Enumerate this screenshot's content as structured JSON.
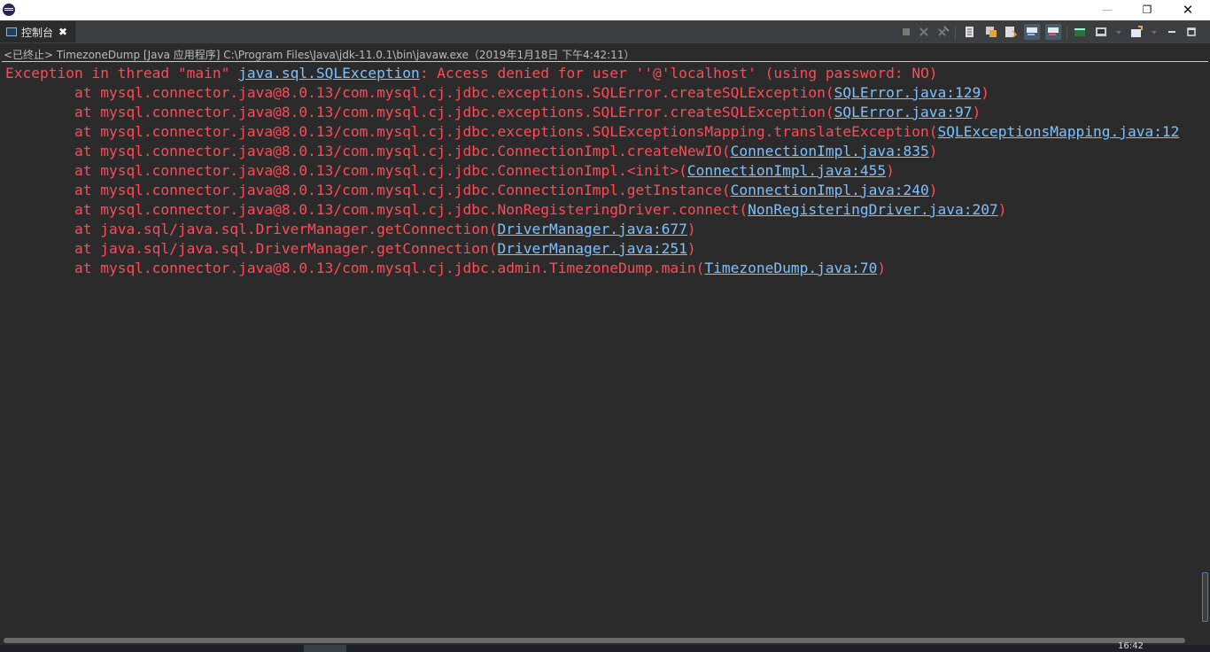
{
  "window": {
    "minimize": "—",
    "restore": "❐",
    "close": "✕"
  },
  "tab": {
    "label": "控制台",
    "close": "✖"
  },
  "toolbar": {
    "icons": [
      "terminate-icon",
      "remove-launch-icon",
      "remove-all-icon",
      "scroll-lock-icon",
      "word-wrap-icon",
      "show-on-output-icon",
      "show-on-error-icon",
      "pin-console-icon",
      "display-console-icon",
      "open-console-icon",
      "minimize-view-icon",
      "maximize-view-icon"
    ]
  },
  "console": {
    "title": "<已终止> TimezoneDump [Java 应用程序] C:\\Program Files\\Java\\jdk-11.0.1\\bin\\javaw.exe（2019年1月18日 下午4:42:11）",
    "lines": [
      {
        "pre": "Exception in thread \"main\" ",
        "link": "java.sql.SQLException",
        "post": ": Access denied for user ''@'localhost' (using password: NO)"
      },
      {
        "pre": "        at mysql.connector.java@8.0.13/com.mysql.cj.jdbc.exceptions.SQLError.createSQLException(",
        "link": "SQLError.java:129",
        "post": ")"
      },
      {
        "pre": "        at mysql.connector.java@8.0.13/com.mysql.cj.jdbc.exceptions.SQLError.createSQLException(",
        "link": "SQLError.java:97",
        "post": ")"
      },
      {
        "pre": "        at mysql.connector.java@8.0.13/com.mysql.cj.jdbc.exceptions.SQLExceptionsMapping.translateException(",
        "link": "SQLExceptionsMapping.java:12",
        "post": ""
      },
      {
        "pre": "        at mysql.connector.java@8.0.13/com.mysql.cj.jdbc.ConnectionImpl.createNewIO(",
        "link": "ConnectionImpl.java:835",
        "post": ")"
      },
      {
        "pre": "        at mysql.connector.java@8.0.13/com.mysql.cj.jdbc.ConnectionImpl.<init>(",
        "link": "ConnectionImpl.java:455",
        "post": ")"
      },
      {
        "pre": "        at mysql.connector.java@8.0.13/com.mysql.cj.jdbc.ConnectionImpl.getInstance(",
        "link": "ConnectionImpl.java:240",
        "post": ")"
      },
      {
        "pre": "        at mysql.connector.java@8.0.13/com.mysql.cj.jdbc.NonRegisteringDriver.connect(",
        "link": "NonRegisteringDriver.java:207",
        "post": ")"
      },
      {
        "pre": "        at java.sql/java.sql.DriverManager.getConnection(",
        "link": "DriverManager.java:677",
        "post": ")"
      },
      {
        "pre": "        at java.sql/java.sql.DriverManager.getConnection(",
        "link": "DriverManager.java:251",
        "post": ")"
      },
      {
        "pre": "        at mysql.connector.java@8.0.13/com.mysql.cj.jdbc.admin.TimezoneDump.main(",
        "link": "TimezoneDump.java:70",
        "post": ")"
      }
    ]
  },
  "taskbar": {
    "clock": "16:42"
  },
  "colors": {
    "background": "#2b2b2b",
    "error_text": "#ff4a57",
    "link": "#7ec1ff",
    "header_text": "#bbbbbb"
  }
}
